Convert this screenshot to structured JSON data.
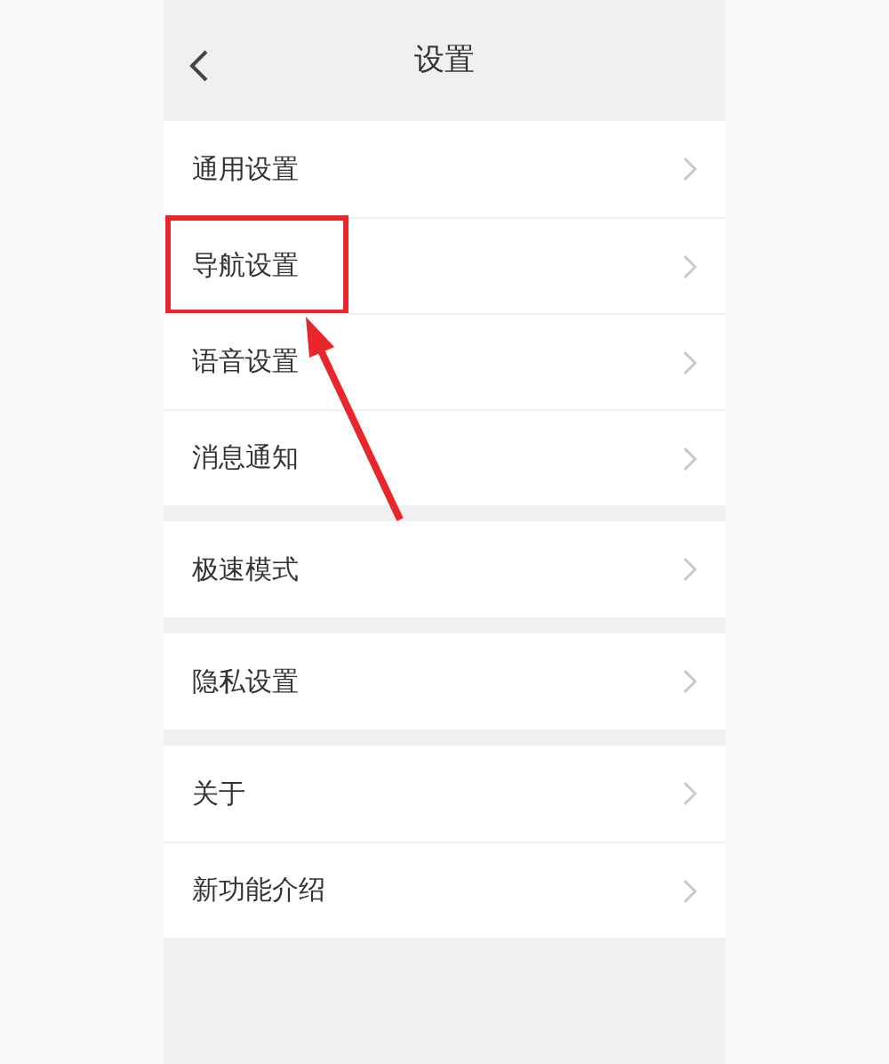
{
  "header": {
    "title": "设置"
  },
  "groups": [
    {
      "items": [
        {
          "label": "通用设置",
          "highlighted": false
        },
        {
          "label": "导航设置",
          "highlighted": true
        },
        {
          "label": "语音设置",
          "highlighted": false
        },
        {
          "label": "消息通知",
          "highlighted": false
        }
      ]
    },
    {
      "items": [
        {
          "label": "极速模式",
          "highlighted": false
        }
      ]
    },
    {
      "items": [
        {
          "label": "隐私设置",
          "highlighted": false
        }
      ]
    },
    {
      "items": [
        {
          "label": "关于",
          "highlighted": false
        },
        {
          "label": "新功能介绍",
          "highlighted": false
        }
      ]
    }
  ]
}
